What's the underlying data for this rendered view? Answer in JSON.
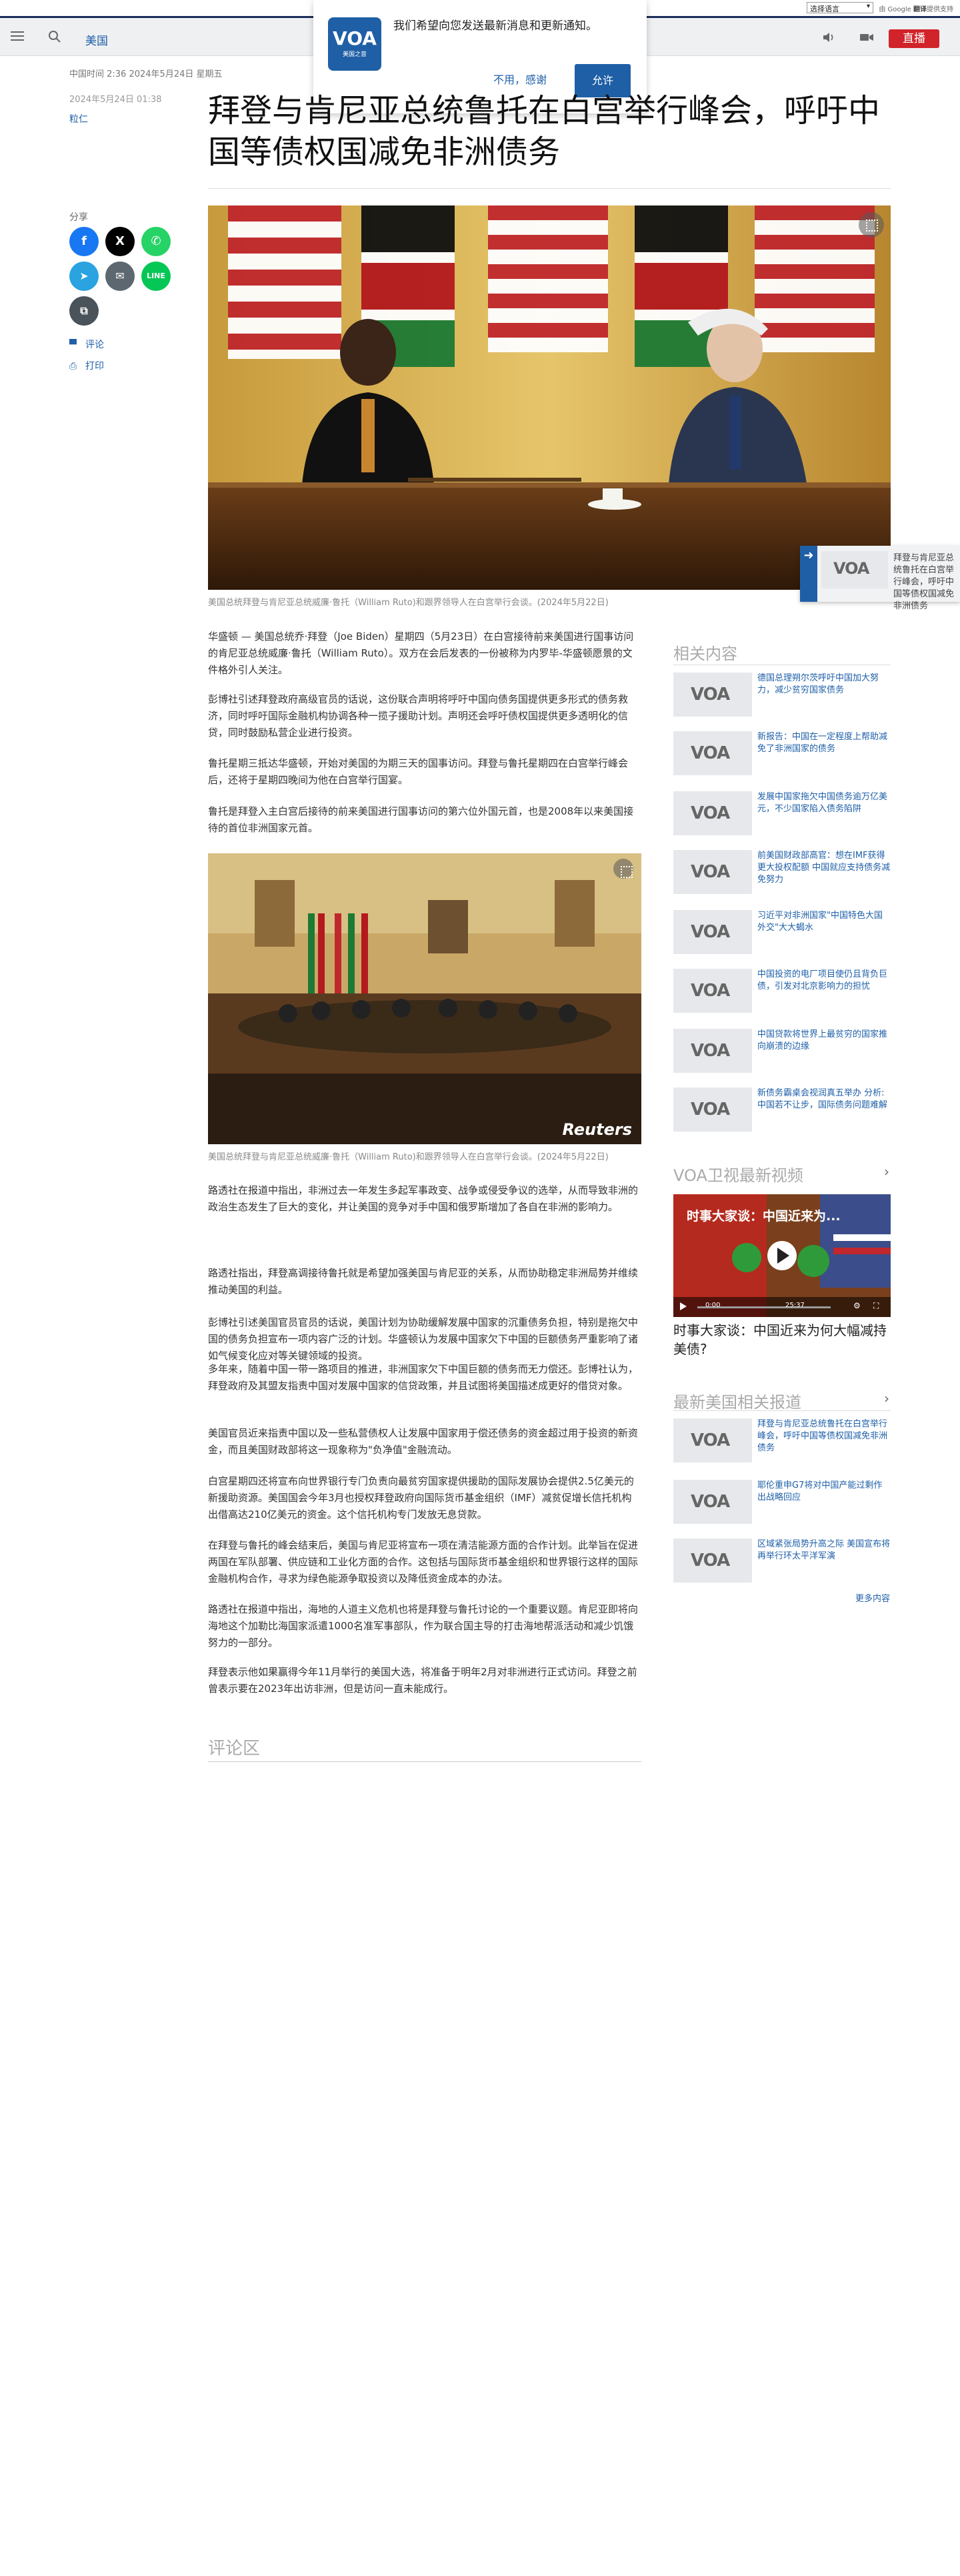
{
  "util": {
    "language_select": "选择语言",
    "powered_prefix": "由 Google",
    "powered_brand": "翻译",
    "powered_suffix": "提供支持"
  },
  "header": {
    "section": "美国",
    "live_label": "直播"
  },
  "notification": {
    "logo_text": "VOA",
    "logo_sub": "美国之音",
    "message": "我们希望向您发送最新消息和更新通知。",
    "decline": "不用，感谢",
    "allow": "允许"
  },
  "article": {
    "dateline": "中国时间 2:36 2024年5月24日 星期五",
    "pubdate": "2024年5月24日 01:38",
    "author": "粒仁",
    "title": "拜登与肯尼亚总统鲁托在白宫举行峰会，呼吁中国等债权国减免非洲债务",
    "share_label": "分享",
    "comment_link": "评论",
    "print_link": "打印",
    "caption_1": "美国总统拜登与肯尼亚总统威廉·鲁托（William Ruto)和跟界领导人在白宫举行会谈。(2024年5月22日)",
    "caption_2": "美国总统拜登与肯尼亚总统威廉·鲁托（William Ruto)和跟界领导人在白宫举行会谈。(2024年5月22日)",
    "photo2_credit": "Reuters",
    "paragraphs_a": [
      "华盛顿 — 美国总统乔·拜登（Joe Biden）星期四（5月23日）在白宫接待前来美国进行国事访问的肯尼亚总统威廉·鲁托（William Ruto）。双方在会后发表的一份被称为内罗毕-华盛顿愿景的文件格外引人关注。",
      "彭博社引述拜登政府高级官员的话说，这份联合声明将呼吁中国向债务国提供更多形式的债务救济，同时呼吁国际金融机构协调各种一揽子援助计划。声明还会呼吁债权国提供更多透明化的信贷，同时鼓励私营企业进行投资。",
      "鲁托星期三抵达华盛顿，开始对美国的为期三天的国事访问。拜登与鲁托星期四在白宫举行峰会后，还将于星期四晚间为他在白宫举行国宴。",
      "鲁托是拜登入主白宫后接待的前来美国进行国事访问的第六位外国元首，也是2008年以来美国接待的首位非洲国家元首。"
    ],
    "paragraphs_b": [
      "路透社在报道中指出，非洲过去一年发生多起军事政变、战争或侵受争议的选举，从而导致非洲的政治生态发生了巨大的变化，并让美国的竞争对手中国和俄罗斯增加了各自在非洲的影响力。",
      "路透社指出，拜登高调接待鲁托就是希望加强美国与肯尼亚的关系，从而协助稳定非洲局势并维续推动美国的利益。",
      "彭博社引述美国官员官员的话说，美国计划为协助缓解发展中国家的沉重债务负担，特别是拖欠中国的债务负担宣布一项内容广泛的计划。华盛顿认为发展中国家欠下中国的巨额债务严重影响了诸如气候变化应对等关键领域的投资。",
      "多年来，随着中国一带一路项目的推进，非洲国家欠下中国巨额的债务而无力偿还。彭博社认为，拜登政府及其盟友指责中国对发展中国家的信贷政策，并且试图将美国描述成更好的借贷对象。",
      "美国官员近来指责中国以及一些私营债权人让发展中国家用于偿还债务的资金超过用于投资的新资金，而且美国财政部将这一现象称为\"负净值\"金融流动。",
      "白宫星期四还将宣布向世界银行专门负责向最贫穷国家提供援助的国际发展协会提供2.5亿美元的新援助资源。美国国会今年3月也授权拜登政府向国际货币基金组织（IMF）减贫促增长信托机构出借高达210亿美元的资金。这个信托机构专门发放无息贷款。",
      "在拜登与鲁托的峰会结束后，美国与肯尼亚将宣布一项在清洁能源方面的合作计划。此举旨在促进两国在军队部署、供应链和工业化方面的合作。这包括与国际货币基金组织和世界银行这样的国际金融机构合作，寻求为绿色能源争取投资以及降低资金成本的办法。",
      "路透社在报道中指出，海地的人道主义危机也将是拜登与鲁托讨论的一个重要议题。肯尼亚即将向海地这个加勒比海国家派遣1000名准军事部队，作为联合国主导的打击海地帮派活动和减少饥饿努力的一部分。",
      "拜登表示他如果赢得今年11月举行的美国大选，将准备于明年2月对非洲进行正式访问。拜登之前曾表示要在2023年出访非洲，但是访问一直未能成行。"
    ],
    "comments_heading": "评论区"
  },
  "sidebar": {
    "related_heading": "相关内容",
    "related": [
      "德国总理朔尔茨呼吁中国加大努力，减少贫穷国家债务",
      "新报告：中国在一定程度上帮助减免了非洲国家的债务",
      "发展中国家拖欠中国债务逾万亿美元，不少国家陷入债务陷阱",
      "前美国财政部高官：想在IMF获得更大投权配额 中国就应支持债务减免努力",
      "习近平对非洲国家\"中国特色大国外交\"大大蝎水",
      "中国投资的电厂项目使仍且背负巨债，引发对北京影响力的担忧",
      "中国贷款将世界上最贫穷的国家推向崩溃的边缘",
      "新债务霸桌会视润真五举办 分析: 中国若不让步，国际债务问题难解"
    ],
    "video_heading": "VOA卫视最新视频",
    "video_overlay_title": "时事大家谈：中国近来为...",
    "video_time_current": "0:00",
    "video_time_total": "25:37",
    "video_title": "时事大家谈：中国近来为何大幅减持美债?",
    "latest_heading": "最新美国相关报道",
    "latest": [
      "拜登与肯尼亚总统鲁托在白宫举行峰会，呼吁中国等债权国减免非洲债务",
      "耶伦重申G7将对中国产能过剩作出战略回应",
      "区域紧张局势升高之际 美国宣布将再举行环太平洋军演"
    ],
    "more_label": "更多内容",
    "float_card_text": "拜登与肯尼亚总统鲁托在白宫举行峰会，呼吁中国等债权国减免非洲债务"
  },
  "colors": {
    "header_border": "#1b2f5a",
    "link_blue": "#1e5fa8",
    "live_red": "#d1232a",
    "voa_blue": "#1f5fa6"
  }
}
